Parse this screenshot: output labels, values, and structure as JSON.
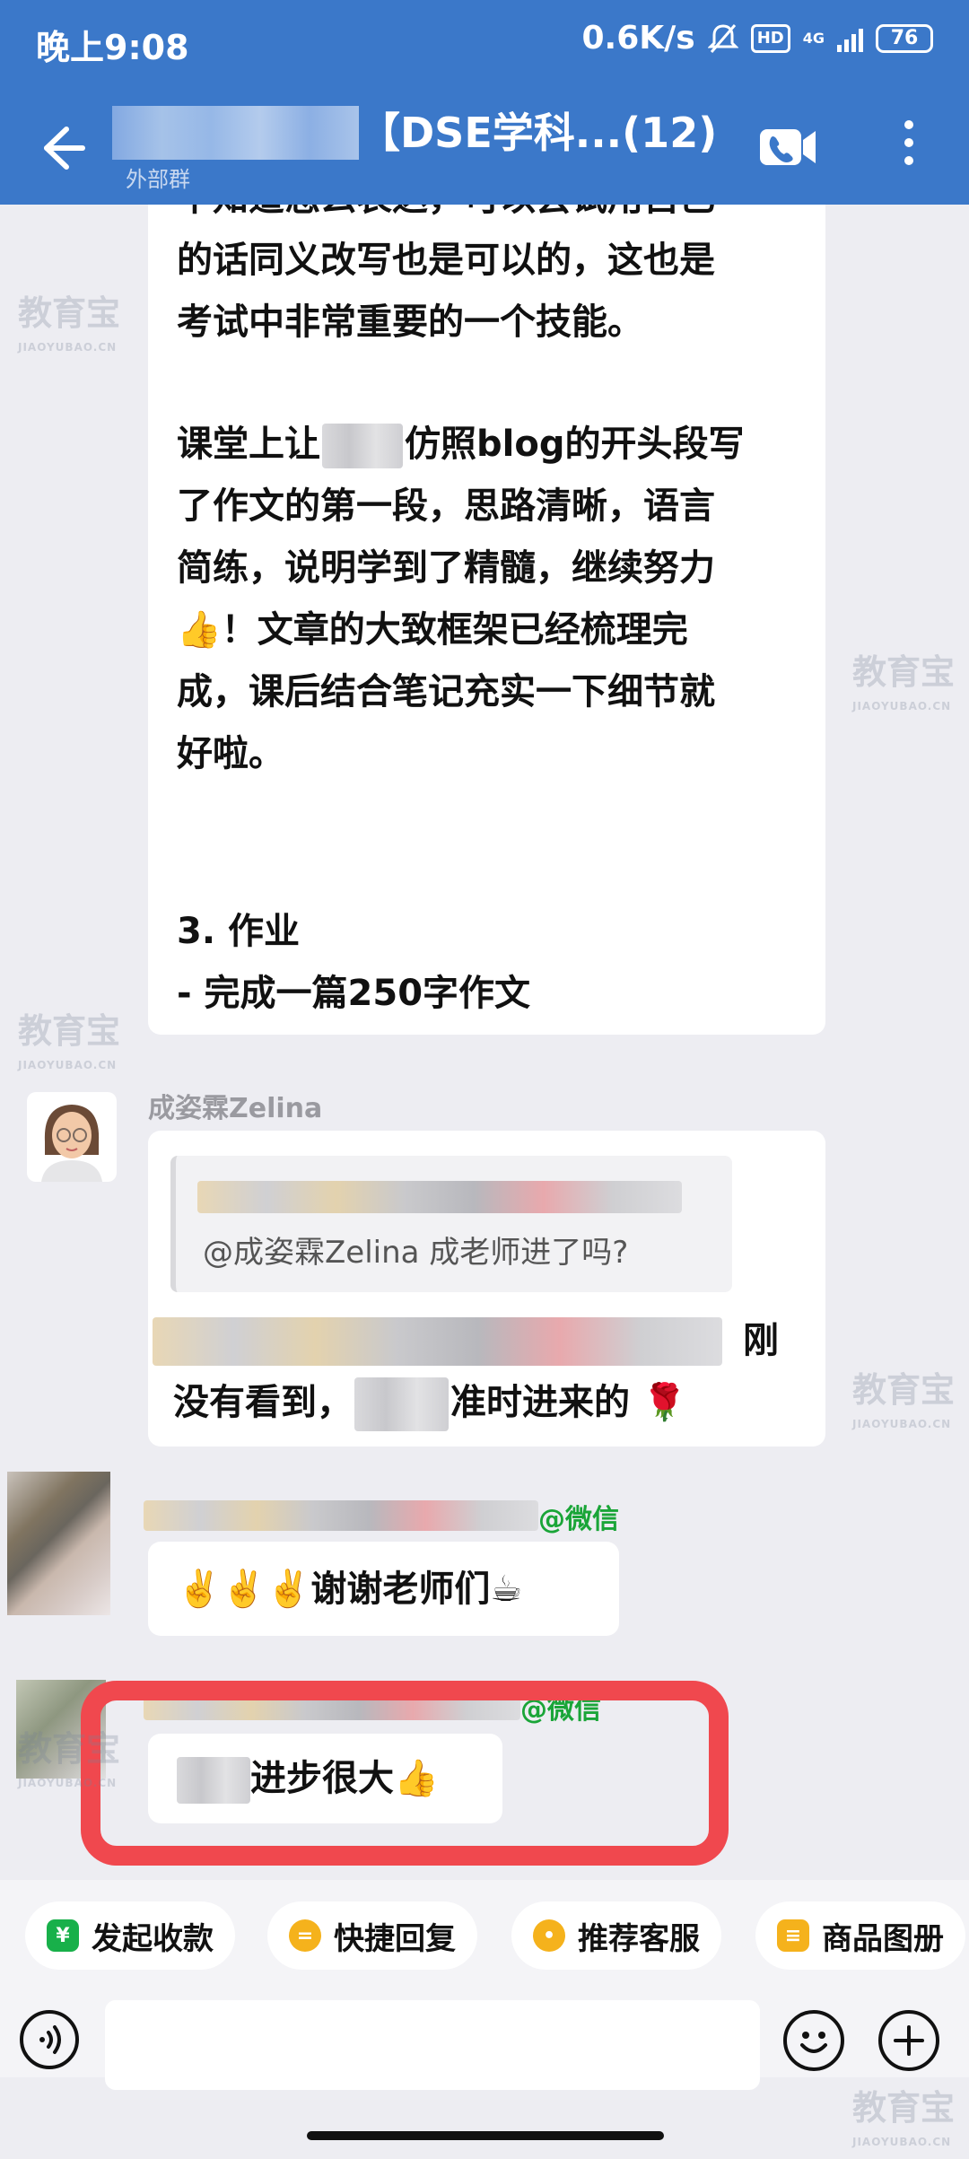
{
  "status_bar": {
    "time": "晚上9:08",
    "speed": "0.6K/s",
    "hd": "HD",
    "network": "4G",
    "battery": "76"
  },
  "header": {
    "title": "【DSE学科...(12)",
    "subtitle": "外部群",
    "back_icon": "back-arrow-icon",
    "video_icon": "video-call-icon",
    "more_icon": "more-vertical-icon"
  },
  "messages": {
    "m1": {
      "lines": [
        "不知道怎么表达，可以尝试用自己",
        "的话同义改写也是可以的，这也是",
        "考试中非常重要的一个技能。",
        "",
        "课堂上让",
        "仿照blog的开头段写",
        "了作文的第一段，思路清晰，语言",
        "简练，说明学到了精髓，继续努力",
        "👍！文章的大致框架已经梳理完",
        "成，课后结合笔记充实一下细节就",
        "好啦。",
        "",
        "",
        "3. 作业",
        "- 完成一篇250字作文"
      ]
    },
    "m2": {
      "sender": "成姿霖Zelina",
      "quote": "@成姿霖Zelina 成老师进了吗?",
      "line1_tail": "刚",
      "line2_a": "没有看到，",
      "line2_b": "准时进来的 🌹"
    },
    "m3": {
      "sender_suffix": "@微信",
      "text": "✌️✌️✌️谢谢老师们☕"
    },
    "m4": {
      "sender_suffix": "@微信",
      "text": "进步很大👍"
    }
  },
  "watermark": {
    "text": "教育宝",
    "sub": "JIAOYUBAO.CN"
  },
  "quick_replies": [
    {
      "label": "发起收款",
      "icon": "yuan-icon",
      "color": "#18b04a"
    },
    {
      "label": "快捷回复",
      "icon": "quick-reply-icon",
      "color": "#f5b21c"
    },
    {
      "label": "推荐客服",
      "icon": "chat-bubble-icon",
      "color": "#f5b21c"
    },
    {
      "label": "商品图册",
      "icon": "catalog-icon",
      "color": "#f5b21c"
    }
  ],
  "input_bar": {
    "voice_icon": "voice-icon",
    "emoji_icon": "emoji-icon",
    "plus_icon": "plus-icon"
  }
}
